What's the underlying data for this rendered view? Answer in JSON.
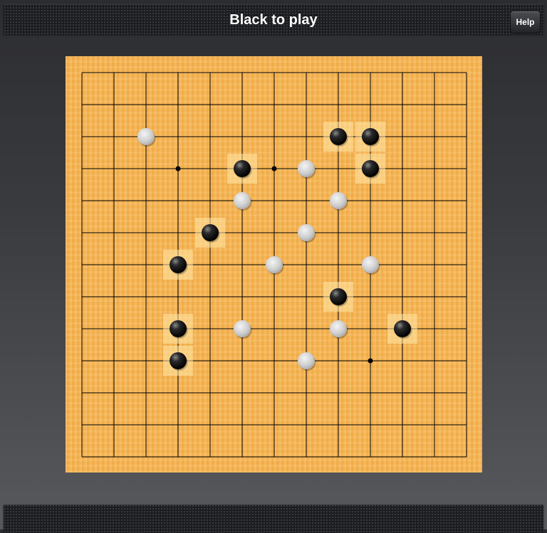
{
  "header": {
    "title": "Black to play",
    "help_label": "Help"
  },
  "board": {
    "size": 13,
    "star_points": [
      [
        3,
        3
      ],
      [
        6,
        3
      ],
      [
        3,
        9
      ],
      [
        9,
        9
      ]
    ],
    "colors": {
      "wood": "#f6b451",
      "line": "#000000",
      "highlight": "#ffe7a8"
    },
    "stones": [
      {
        "color": "white",
        "col": 2,
        "row": 2
      },
      {
        "color": "black",
        "col": 8,
        "row": 2
      },
      {
        "color": "black",
        "col": 9,
        "row": 2
      },
      {
        "color": "black",
        "col": 5,
        "row": 3
      },
      {
        "color": "white",
        "col": 7,
        "row": 3
      },
      {
        "color": "black",
        "col": 9,
        "row": 3
      },
      {
        "color": "white",
        "col": 5,
        "row": 4
      },
      {
        "color": "white",
        "col": 8,
        "row": 4
      },
      {
        "color": "black",
        "col": 4,
        "row": 5
      },
      {
        "color": "white",
        "col": 7,
        "row": 5
      },
      {
        "color": "black",
        "col": 3,
        "row": 6
      },
      {
        "color": "white",
        "col": 6,
        "row": 6
      },
      {
        "color": "white",
        "col": 9,
        "row": 6
      },
      {
        "color": "black",
        "col": 8,
        "row": 7
      },
      {
        "color": "black",
        "col": 3,
        "row": 8
      },
      {
        "color": "white",
        "col": 5,
        "row": 8
      },
      {
        "color": "white",
        "col": 8,
        "row": 8
      },
      {
        "color": "black",
        "col": 10,
        "row": 8
      },
      {
        "color": "black",
        "col": 3,
        "row": 9
      },
      {
        "color": "white",
        "col": 7,
        "row": 9
      }
    ]
  }
}
